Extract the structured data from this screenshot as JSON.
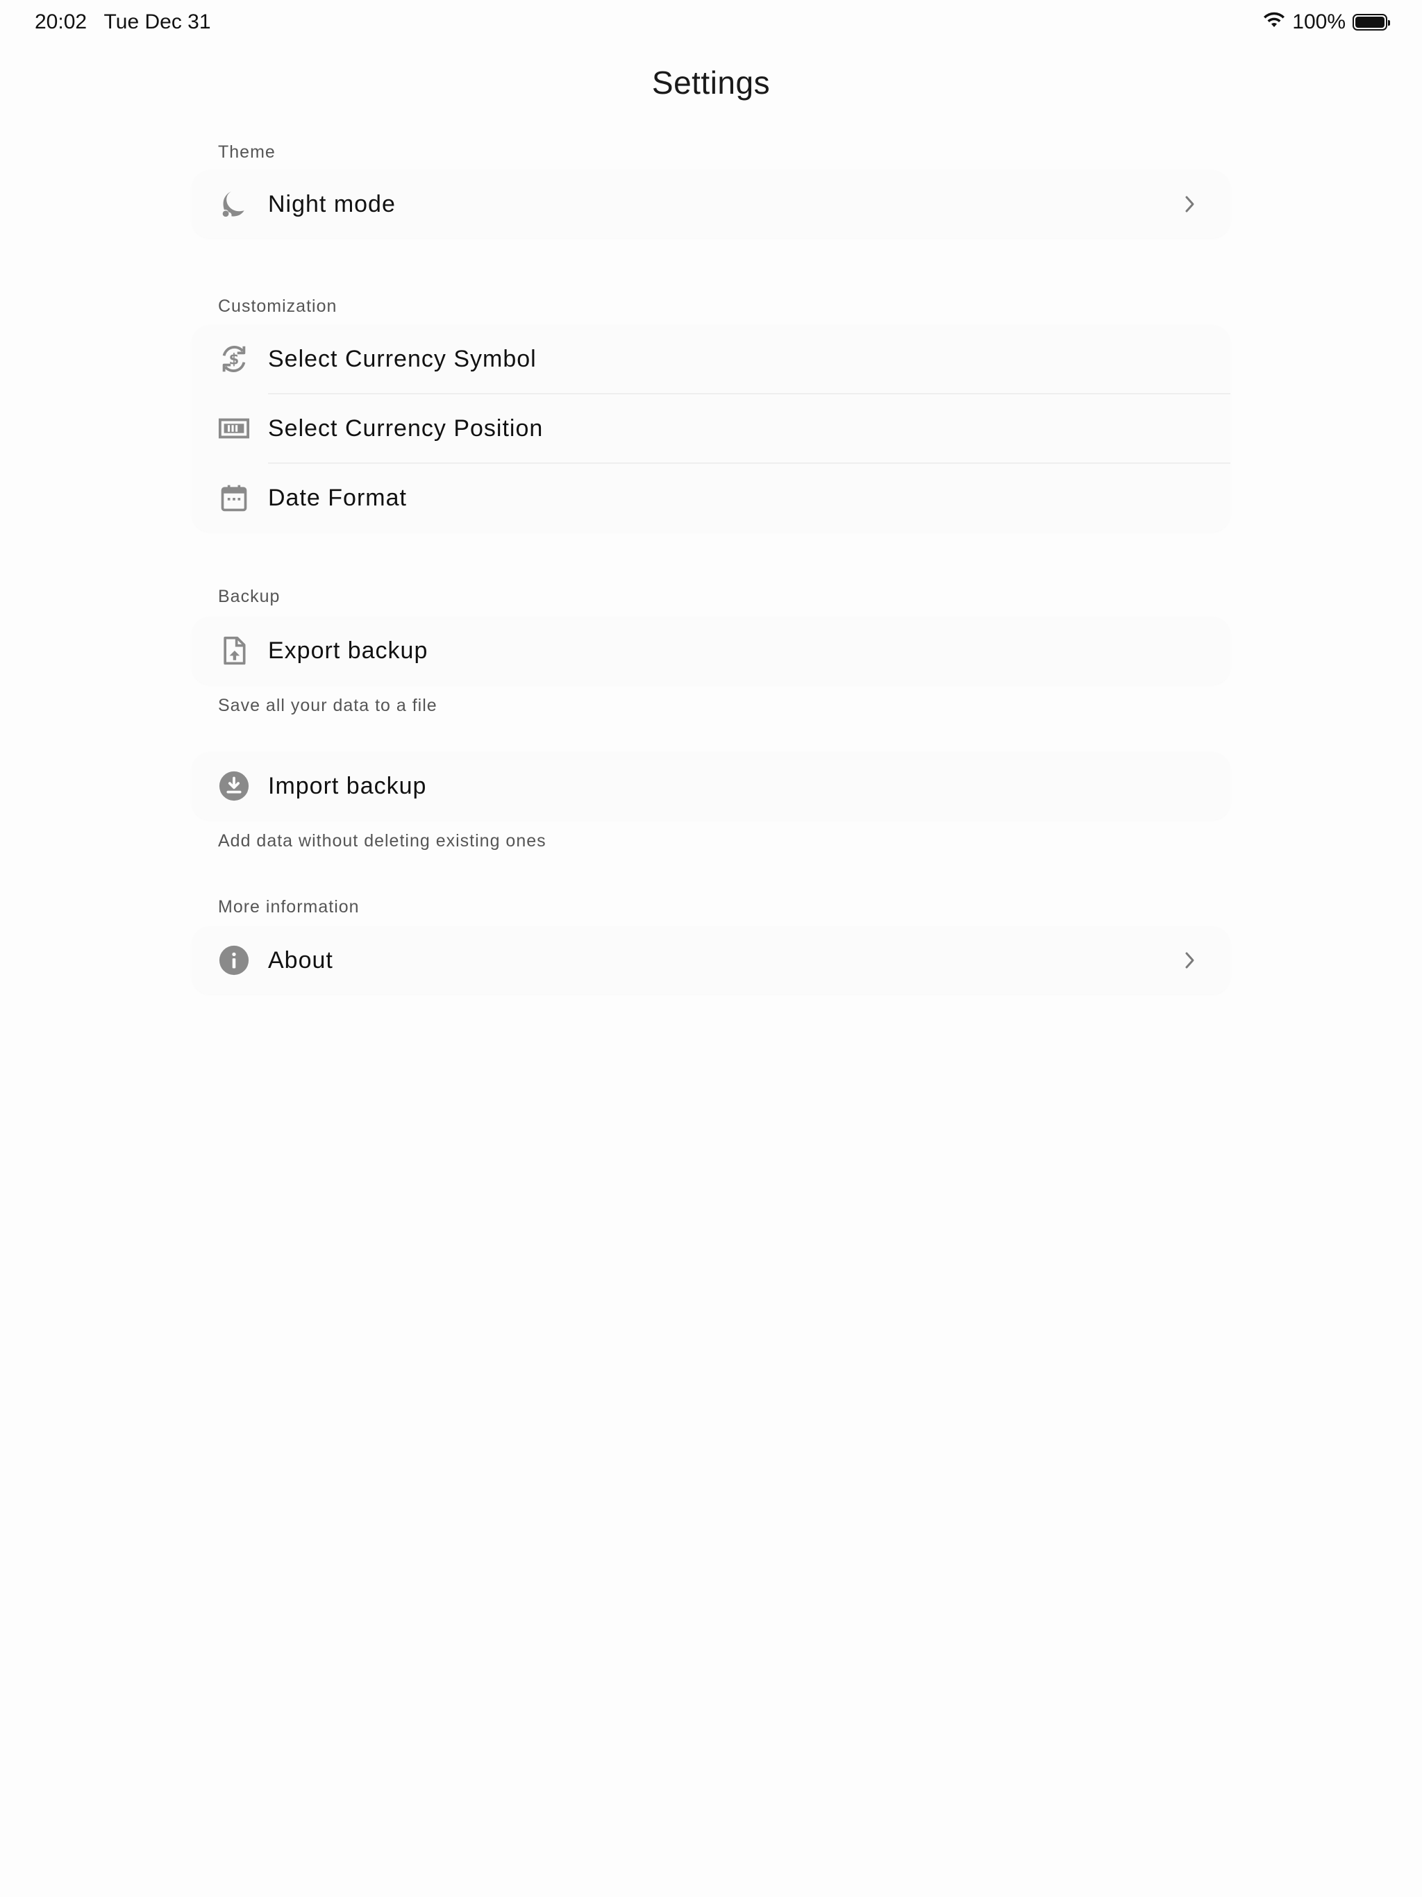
{
  "status_bar": {
    "time": "20:02",
    "date": "Tue Dec 31",
    "battery_text": "100%",
    "battery_level": 1.0
  },
  "page": {
    "title": "Settings"
  },
  "sections": {
    "theme": {
      "label": "Theme",
      "night_mode": {
        "label": "Night mode",
        "icon": "moon-icon"
      }
    },
    "customization": {
      "label": "Customization",
      "currency_symbol": {
        "label": "Select Currency Symbol",
        "icon": "currency-exchange-icon"
      },
      "currency_position": {
        "label": "Select Currency Position",
        "icon": "currency-position-icon"
      },
      "date_format": {
        "label": "Date Format",
        "icon": "calendar-icon"
      }
    },
    "backup": {
      "label": "Backup",
      "export": {
        "label": "Export backup",
        "icon": "file-upload-icon",
        "helper": "Save all your data to a file"
      },
      "import": {
        "label": "Import backup",
        "icon": "download-circle-icon",
        "helper": "Add data without deleting existing ones"
      }
    },
    "more_info": {
      "label": "More information",
      "about": {
        "label": "About",
        "icon": "info-icon"
      }
    }
  },
  "colors": {
    "background": "#fdfdfd",
    "card": "#fbfbfb",
    "icon": "#8a8a8a",
    "secondary_text": "#555555"
  }
}
